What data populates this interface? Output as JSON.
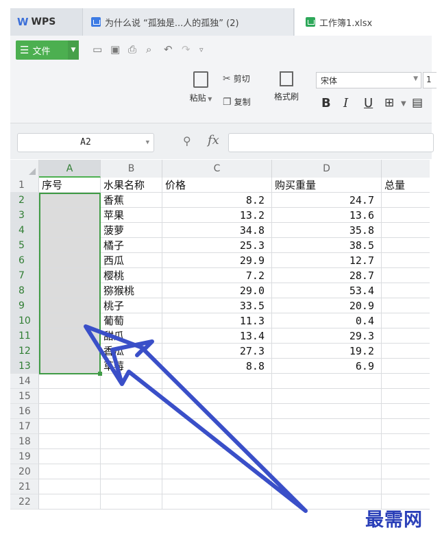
{
  "tabs": [
    {
      "label": "WPS",
      "logo": "W"
    },
    {
      "label": "为什么说 “孤独是...人的孤独” (2)"
    },
    {
      "label": "工作簿1.xlsx"
    }
  ],
  "toolbar": {
    "file_label": "文件",
    "quick_access": [
      "open-icon",
      "save-icon",
      "print-icon",
      "print-preview-icon",
      "undo-icon",
      "redo-icon",
      "customize-icon"
    ]
  },
  "ribbon": {
    "paste_label": "粘贴",
    "cut_label": "剪切",
    "copy_label": "复制",
    "format_painter_label": "格式刷",
    "font_name": "宋体",
    "font_size": "1",
    "format_buttons": [
      "B",
      "I",
      "U"
    ]
  },
  "formula_bar": {
    "name_box": "A2",
    "fx": "fx",
    "formula": ""
  },
  "columns": [
    "A",
    "B",
    "C",
    "D"
  ],
  "rows": [
    {
      "n": "1",
      "a": "序号",
      "b": "水果名称",
      "c": "价格",
      "d": "购买重量",
      "e": "总量"
    },
    {
      "n": "2",
      "a": "",
      "b": "香蕉",
      "c": "8.2",
      "d": "24.7",
      "e": ""
    },
    {
      "n": "3",
      "a": "",
      "b": "苹果",
      "c": "13.2",
      "d": "13.6",
      "e": ""
    },
    {
      "n": "4",
      "a": "",
      "b": "菠萝",
      "c": "34.8",
      "d": "35.8",
      "e": ""
    },
    {
      "n": "5",
      "a": "",
      "b": "橘子",
      "c": "25.3",
      "d": "38.5",
      "e": ""
    },
    {
      "n": "6",
      "a": "",
      "b": "西瓜",
      "c": "29.9",
      "d": "12.7",
      "e": ""
    },
    {
      "n": "7",
      "a": "",
      "b": "樱桃",
      "c": "7.2",
      "d": "28.7",
      "e": ""
    },
    {
      "n": "8",
      "a": "",
      "b": "猕猴桃",
      "c": "29.0",
      "d": "53.4",
      "e": ""
    },
    {
      "n": "9",
      "a": "",
      "b": "桃子",
      "c": "33.5",
      "d": "20.9",
      "e": ""
    },
    {
      "n": "10",
      "a": "",
      "b": "葡萄",
      "c": "11.3",
      "d": "0.4",
      "e": ""
    },
    {
      "n": "11",
      "a": "",
      "b": "甜瓜",
      "c": "13.4",
      "d": "29.3",
      "e": ""
    },
    {
      "n": "12",
      "a": "",
      "b": "香瓜",
      "c": "27.3",
      "d": "19.2",
      "e": ""
    },
    {
      "n": "13",
      "a": "",
      "b": "草莓",
      "c": "8.8",
      "d": "6.9",
      "e": ""
    },
    {
      "n": "14",
      "a": "",
      "b": "",
      "c": "",
      "d": "",
      "e": ""
    },
    {
      "n": "15",
      "a": "",
      "b": "",
      "c": "",
      "d": "",
      "e": ""
    },
    {
      "n": "16",
      "a": "",
      "b": "",
      "c": "",
      "d": "",
      "e": ""
    },
    {
      "n": "17",
      "a": "",
      "b": "",
      "c": "",
      "d": "",
      "e": ""
    },
    {
      "n": "18",
      "a": "",
      "b": "",
      "c": "",
      "d": "",
      "e": ""
    },
    {
      "n": "19",
      "a": "",
      "b": "",
      "c": "",
      "d": "",
      "e": ""
    },
    {
      "n": "20",
      "a": "",
      "b": "",
      "c": "",
      "d": "",
      "e": ""
    },
    {
      "n": "21",
      "a": "",
      "b": "",
      "c": "",
      "d": "",
      "e": ""
    },
    {
      "n": "22",
      "a": "",
      "b": "",
      "c": "",
      "d": "",
      "e": ""
    }
  ],
  "selected_range": "A2:A13",
  "annotation_color": "#3a4fc8",
  "accent_color": "#4caf50",
  "watermark": "最需网"
}
